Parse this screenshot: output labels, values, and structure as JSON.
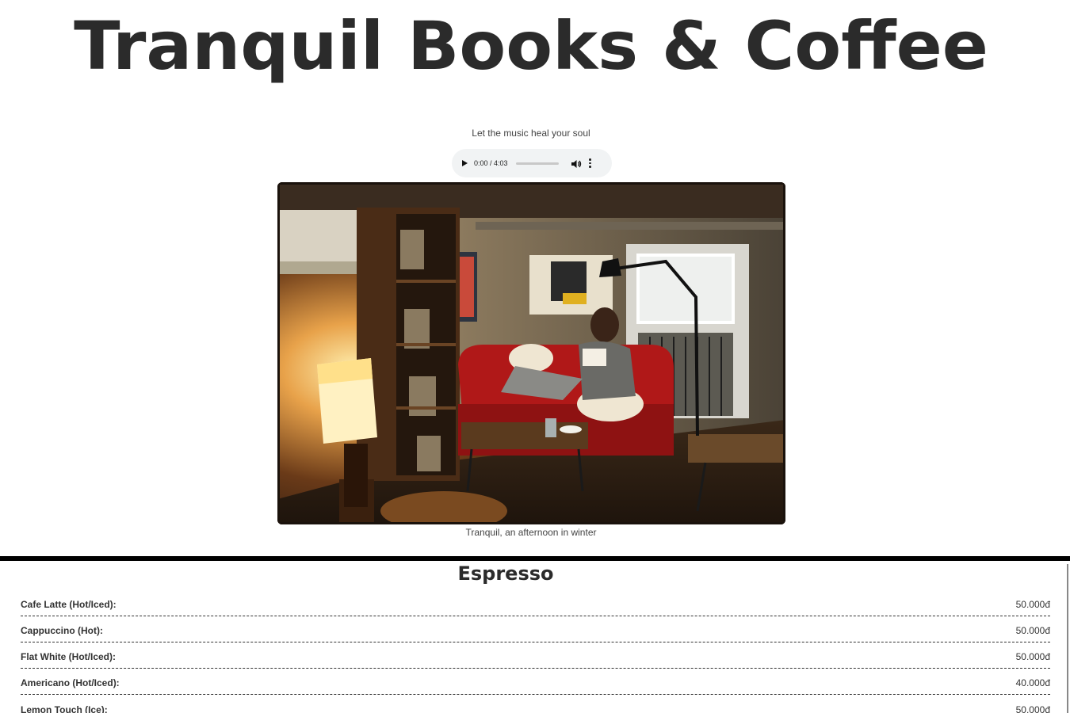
{
  "header": {
    "title": "Tranquil Books & Coffee"
  },
  "player": {
    "tagline": "Let the music heal your soul",
    "time": "0:00 / 4:03",
    "progress": 0,
    "icons": [
      "play-icon",
      "volume-icon",
      "more-options-icon"
    ]
  },
  "photo": {
    "caption": "Tranquil, an afternoon in winter"
  },
  "menu": {
    "section_title": "Espresso",
    "items": [
      {
        "name": "Cafe Latte (Hot/Iced):",
        "price": "50.000đ"
      },
      {
        "name": "Cappuccino (Hot):",
        "price": "50.000đ"
      },
      {
        "name": "Flat White (Hot/Iced):",
        "price": "50.000đ"
      },
      {
        "name": "Americano (Hot/Iced):",
        "price": "40.000đ"
      },
      {
        "name": "Lemon Touch (Ice):",
        "price": "50.000đ"
      }
    ]
  }
}
